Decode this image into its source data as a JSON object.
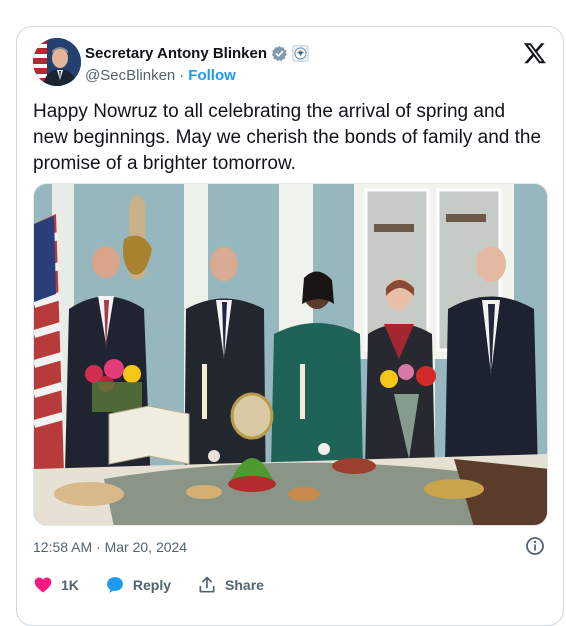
{
  "author": {
    "display_name": "Secretary Antony Blinken",
    "handle": "@SecBlinken",
    "separator": "·",
    "follow_label": "Follow"
  },
  "tweet": {
    "text": "Happy Nowruz to all celebrating the arrival of spring and new beginnings. May we cherish the bonds of family and the promise of a brighter tomorrow.",
    "timestamp": "12:58 AM · Mar 20, 2024"
  },
  "actions": {
    "like_count": "1K",
    "reply_label": "Reply",
    "share_label": "Share"
  },
  "icons": {
    "verified": "verified-badge-icon",
    "affiliation": "government-seal-icon",
    "platform": "x-logo-icon",
    "info": "info-icon",
    "like": "heart-icon",
    "reply": "speech-bubble-icon",
    "share": "share-icon"
  },
  "colors": {
    "accent": "#1d9bf0",
    "like": "#f91880",
    "text": "#0f1419",
    "muted": "#536471",
    "border": "#cfd9de"
  }
}
